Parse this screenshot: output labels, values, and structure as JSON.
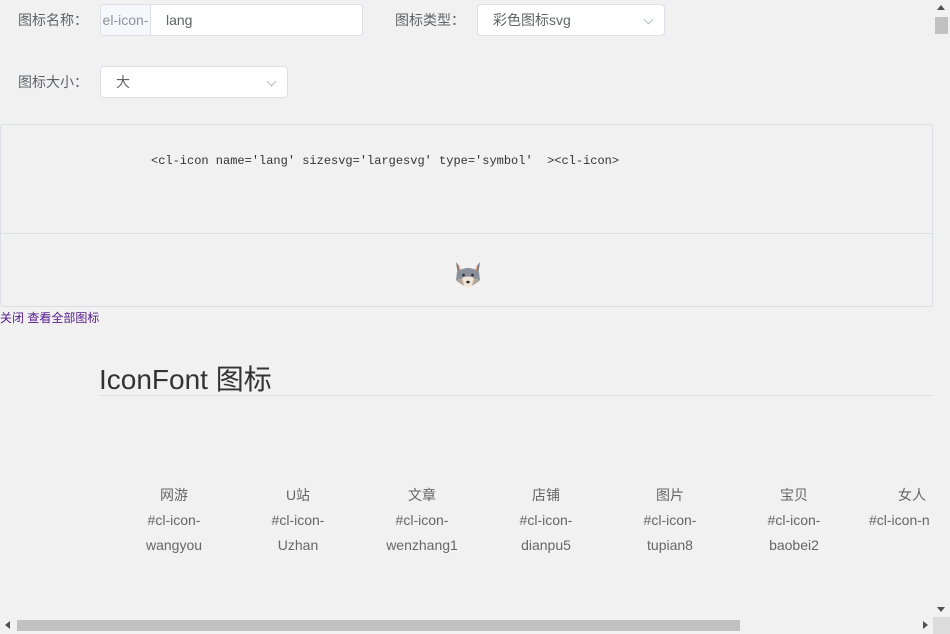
{
  "form": {
    "name_label": "图标名称：",
    "name_prefix": "el-icon-",
    "name_value": "lang",
    "type_label": "图标类型：",
    "type_value": "彩色图标svg",
    "size_label": "图标大小：",
    "size_value": "大"
  },
  "preview": {
    "code": "<cl-icon name='lang' sizesvg='largesvg' type='symbol'  ><cl-icon>",
    "icon": "wolf-icon"
  },
  "links": {
    "close": "关闭",
    "view_all": "查看全部图标"
  },
  "section": {
    "title": "IconFont 图标"
  },
  "icons": [
    {
      "name": "网游",
      "prefix": "#cl-icon-",
      "id": "wangyou"
    },
    {
      "name": "U站",
      "prefix": "#cl-icon-",
      "id": "Uzhan"
    },
    {
      "name": "文章",
      "prefix": "#cl-icon-",
      "id": "wenzhang1"
    },
    {
      "name": "店铺",
      "prefix": "#cl-icon-",
      "id": "dianpu5"
    },
    {
      "name": "图片",
      "prefix": "#cl-icon-",
      "id": "tupian8"
    },
    {
      "name": "宝贝",
      "prefix": "#cl-icon-",
      "id": "baobei2"
    },
    {
      "name": "女人",
      "prefix": "#cl-icon-n",
      "id": ""
    }
  ],
  "colors": {
    "background": "#f1f1f1",
    "border": "#dcdfe6",
    "link": "#551a8b"
  }
}
